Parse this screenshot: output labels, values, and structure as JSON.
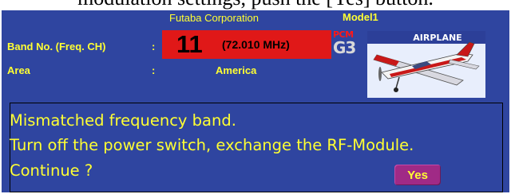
{
  "caption": "modulation settings, push the [Yes] button.",
  "header": {
    "manufacturer": "Futaba Corporation",
    "model_name": "Model1"
  },
  "band": {
    "label": "Band No. (Freq. CH)",
    "separator": ":",
    "channel": "11",
    "frequency": "(72.010 MHz)"
  },
  "modulation": {
    "type": "PCM",
    "generation": "G3"
  },
  "area": {
    "label": "Area",
    "separator": ":",
    "value": "America"
  },
  "model_image": {
    "banner": "AIRPLANE",
    "icon": "airplane-image"
  },
  "dialog": {
    "line1": "Mismatched frequency band.",
    "line2": "Turn off the power switch, exchange the RF-Module.",
    "prompt": "Continue ?",
    "yes_label": "Yes"
  },
  "colors": {
    "screen_bg": "#2f45a0",
    "text_yellow": "#ffff33",
    "band_red": "#e01818",
    "button_purple": "#a02a86"
  }
}
